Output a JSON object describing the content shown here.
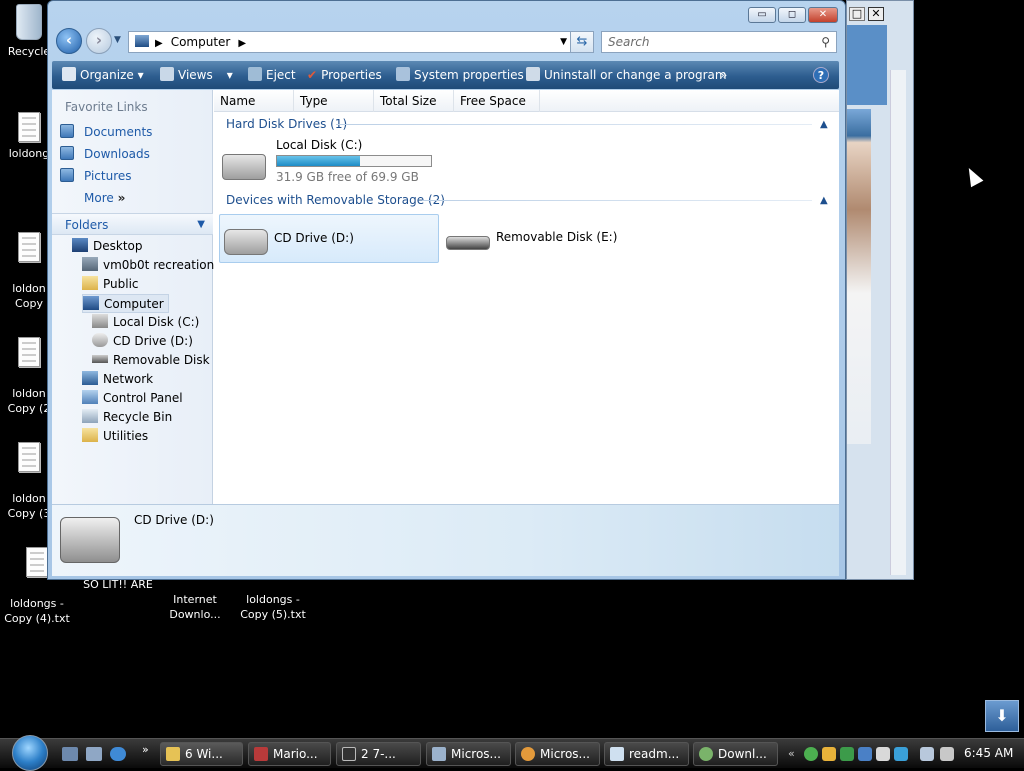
{
  "desktop": {
    "icons": [
      {
        "label": "Recycle"
      },
      {
        "label": "loldong"
      },
      {
        "label": "loldon\nCopy"
      },
      {
        "label": "loldon\nCopy (2"
      },
      {
        "label": "loldon\nCopy (3"
      },
      {
        "label": "loldongs -\nCopy (4).txt"
      },
      {
        "label": "SO LIT!! ARE"
      },
      {
        "label": "Internet\nDownlo..."
      },
      {
        "label": "loldongs -\nCopy (5).txt"
      }
    ]
  },
  "window": {
    "title_controls": {
      "minimize": "▭",
      "maximize": "◻",
      "close": "✕"
    },
    "address": {
      "crumb": "Computer",
      "search_placeholder": "Search"
    },
    "toolbar": {
      "organize": "Organize",
      "views": "Views",
      "eject": "Eject",
      "properties": "Properties",
      "system_properties": "System properties",
      "uninstall": "Uninstall or change a program",
      "more": "»"
    },
    "nav": {
      "favorite_links": "Favorite Links",
      "favorites": [
        "Documents",
        "Downloads",
        "Pictures"
      ],
      "more": "More",
      "folders": "Folders",
      "tree": [
        "Desktop",
        "vm0b0t recreation",
        "Public",
        "Computer",
        "Local Disk (C:)",
        "CD Drive (D:)",
        "Removable Disk (E",
        "Network",
        "Control Panel",
        "Recycle Bin",
        "Utilities"
      ]
    },
    "columns": [
      "Name",
      "Type",
      "Total Size",
      "Free Space"
    ],
    "groups": {
      "hard_disk": "Hard Disk Drives (1)",
      "removable": "Devices with Removable Storage (2)"
    },
    "drives": {
      "local_disk": {
        "name": "Local Disk (C:)",
        "free": "31.9 GB free of 69.9 GB",
        "used_fraction": 0.54
      },
      "cd_drive": {
        "name": "CD Drive (D:)"
      },
      "removable": {
        "name": "Removable Disk (E:)"
      }
    },
    "details": {
      "name": "CD Drive (D:)"
    }
  },
  "taskbar": {
    "buttons": [
      "6 Wi...",
      "Mario...",
      "2 7-...",
      "Micros...",
      "Micros...",
      "readm...",
      "Downl..."
    ],
    "clock": "6:45 AM"
  }
}
